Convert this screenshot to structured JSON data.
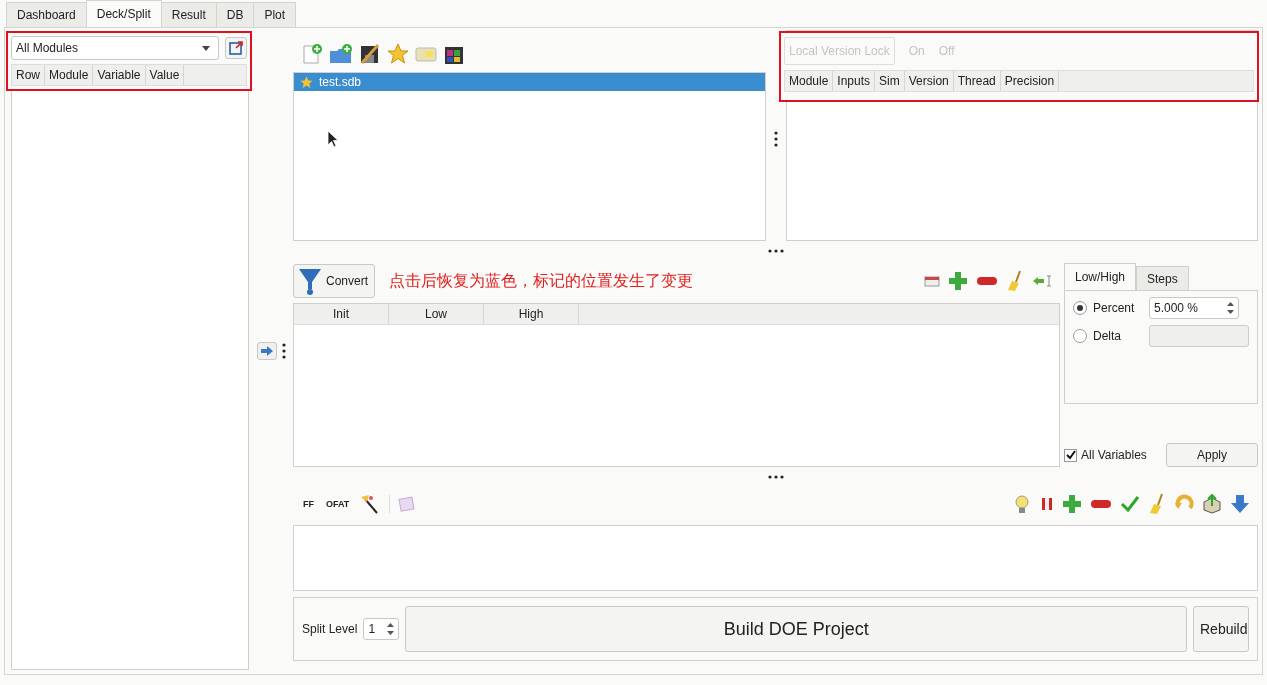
{
  "tabs": [
    {
      "label": "Dashboard",
      "selected": false
    },
    {
      "label": "Deck/Split",
      "selected": true
    },
    {
      "label": "Result",
      "selected": false
    },
    {
      "label": "DB",
      "selected": false
    },
    {
      "label": "Plot",
      "selected": false
    }
  ],
  "variables_panel": {
    "module_select": "All Modules",
    "columns": [
      "Row",
      "Module",
      "Variable",
      "Value"
    ]
  },
  "files": [
    {
      "name": "test.sdb",
      "selected": true
    }
  ],
  "version_lock": {
    "button": "Local Version Lock",
    "disabled": true,
    "options": [
      "On",
      "Off"
    ],
    "columns": [
      "Module",
      "Inputs",
      "Sim",
      "Version",
      "Thread",
      "Precision"
    ]
  },
  "convert_button": "Convert",
  "annotation": "点击后恢复为蓝色，标记的位置发生了变更",
  "range_table": {
    "columns": [
      "Init",
      "Low",
      "High"
    ]
  },
  "range_tabs": [
    {
      "label": "Low/High",
      "selected": true
    },
    {
      "label": "Steps",
      "selected": false
    }
  ],
  "range_modes": [
    {
      "label": "Percent",
      "selected": true,
      "value": "5.000 %"
    },
    {
      "label": "Delta",
      "selected": false
    }
  ],
  "all_variables": {
    "label": "All Variables",
    "checked": true
  },
  "apply_button": "Apply",
  "doe_toolbar": [
    "FF",
    "OFAT"
  ],
  "split_level": {
    "label": "Split Level",
    "value": "1"
  },
  "build_button": "Build DOE Project",
  "rebuild_button": "Rebuild"
}
